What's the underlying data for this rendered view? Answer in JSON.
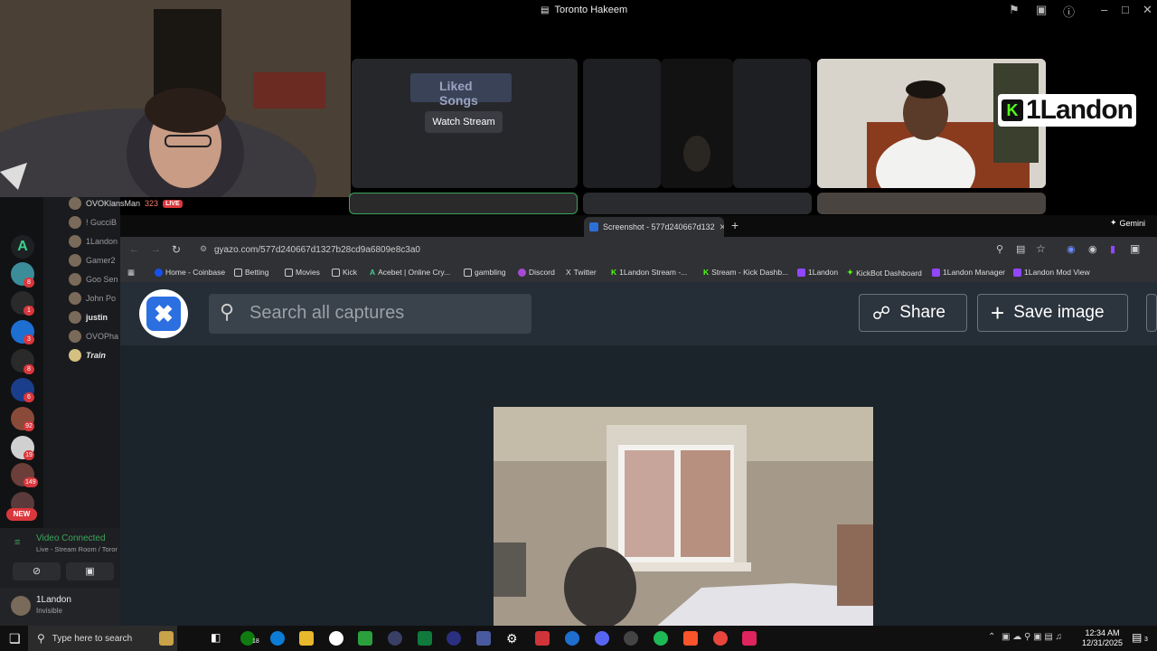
{
  "call": {
    "title": "Toronto Hakeem",
    "watch_stream_label": "Watch Stream",
    "liked_songs_label": "Liked Songs",
    "overlay_username": "1Landon"
  },
  "discord": {
    "server_badges": [
      "8",
      "1",
      "3",
      "8",
      "6",
      "92",
      "19",
      "149"
    ],
    "new_badge": "NEW",
    "members": [
      {
        "name": "OVOKlansMan",
        "count": "323",
        "live": "LIVE"
      },
      {
        "name": "! GucciB"
      },
      {
        "name": "1Landon"
      },
      {
        "name": "Gamer2"
      },
      {
        "name": "Goo Sen"
      },
      {
        "name": "John Po"
      },
      {
        "name": "justin"
      },
      {
        "name": "OVOPha"
      },
      {
        "name": "Train"
      }
    ],
    "voice_status": "Video Connected",
    "voice_room": "Live - Stream Room / Toror",
    "user_name": "1Landon",
    "user_status": "Invisible"
  },
  "browser": {
    "tab_title": "Screenshot - 577d240667d132",
    "gemini_label": "Gemini",
    "url": "gyazo.com/577d240667d1327b28cd9a6809e8c3a0",
    "bookmarks": [
      "Home - Coinbase",
      "Betting",
      "Movies",
      "Kick",
      "Acebet | Online Cry...",
      "gambling",
      "Discord",
      "Twitter",
      "1Landon Stream -...",
      "Stream - Kick Dashb...",
      "1Landon",
      "KickBot Dashboard",
      "1Landon Manager",
      "1Landon Mod View"
    ]
  },
  "gyazo": {
    "search_placeholder": "Search all captures",
    "share_label": "Share",
    "save_label": "Save image"
  },
  "taskbar": {
    "search_placeholder": "Type here to search",
    "xbox_badge": "18",
    "time": "12:34 AM",
    "date": "12/31/2025",
    "notif_count": "3"
  }
}
